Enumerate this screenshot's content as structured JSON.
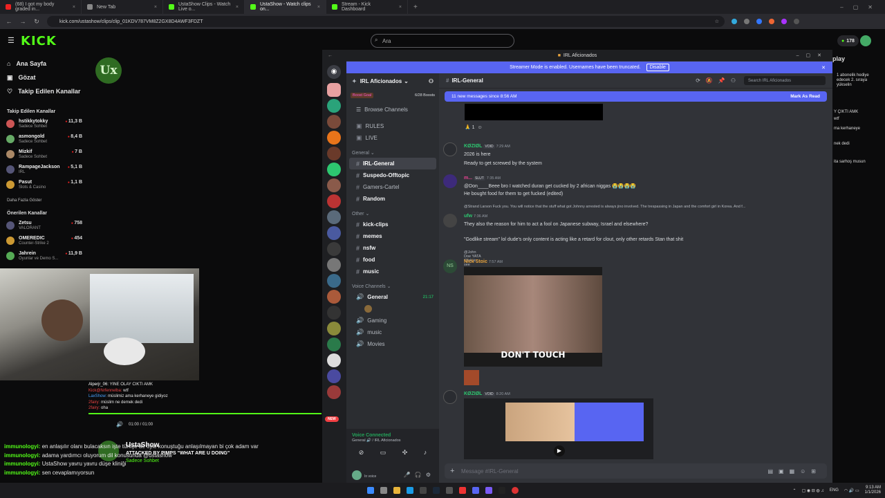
{
  "browser": {
    "tabs": [
      {
        "label": "(68) I got my body graded in..."
      },
      {
        "label": "New Tab"
      },
      {
        "label": "UstaShow Clips - Watch Live o..."
      },
      {
        "label": "UstaShow - Watch clips on..."
      },
      {
        "label": "Stream - Kick Dashboard"
      }
    ],
    "url": "kick.com/ustashow/clips/clip_01KDV787VM8Z2GX8D4AWF3FDZT"
  },
  "kick": {
    "logo": "KICK",
    "search_placeholder": "Ara",
    "credits": "178",
    "nav": [
      {
        "label": "Ana Sayfa"
      },
      {
        "label": "Gözat"
      },
      {
        "label": "Takip Edilen Kanallar"
      }
    ],
    "followed_header": "Takip Edilen Kanallar",
    "followed": [
      {
        "name": "hstikkytokky",
        "sub": "Sadece Sohbet",
        "viewers": "11,3 B"
      },
      {
        "name": "asmongold",
        "sub": "Sadece Sohbet",
        "viewers": "8,4 B"
      },
      {
        "name": "Mizkif",
        "sub": "Sadece Sohbet",
        "viewers": "7 B"
      },
      {
        "name": "RampageJackson",
        "sub": "IRL",
        "viewers": "5,1 B"
      },
      {
        "name": "Pasut",
        "sub": "Slots & Casino",
        "viewers": "1,1 B"
      }
    ],
    "show_more": "Daha Fazla Göster",
    "suggested_header": "Önerilen Kanallar",
    "suggested": [
      {
        "name": "Zetsu",
        "sub": "VALORANT",
        "viewers": "758"
      },
      {
        "name": "OMEREDIC",
        "sub": "Counter-Strike 2",
        "viewers": "454"
      },
      {
        "name": "Jahrein",
        "sub": "Oyunlar ve Demo S...",
        "viewers": "11,9 B"
      }
    ],
    "stream_logo": "Ux",
    "overlay_chat": [
      {
        "user": "Alperjr_06:",
        "text": "YINE OLAY CIKTI AMK",
        "color": "#ffffff"
      },
      {
        "user": "Kick@Nrfennelba:",
        "text": "wtf",
        "color": "#e94343"
      },
      {
        "user": "LaxShow:",
        "text": "müslimiz ama kerhaneye gidiyoz",
        "color": "#4aa3ff"
      },
      {
        "user": "2fairy:",
        "text": "müslim ne demek dedi",
        "color": "#e94343"
      },
      {
        "user": "2fairy:",
        "text": "oha",
        "color": "#e94343"
      }
    ],
    "video_time": "01:00 / 01:00",
    "streamer_name": "UstaShow",
    "streamer_sub": "Sadece Sohbet",
    "alert": "ATTACKED BY PIMPS \"WHAT ARE U DOING\"",
    "chat": [
      {
        "user": "immunologyi:",
        "text": "en anlaşılır olanı bulacaksın işte türkçe de öyle konuştuğu anlaşılmayan bi çok adam var"
      },
      {
        "user": "immunologyi:",
        "text": "adama yardımcı oluyorum dil konusunda @ustashow"
      },
      {
        "user": "immunologyi:",
        "text": "UstaShow yavru yavru düşe kliniği"
      },
      {
        "user": "immunologyi:",
        "text": "sen cevaplamıyorsun"
      }
    ],
    "right_panel": {
      "title": "play",
      "lines": [
        "1 abonelik hediye edecek 2. sıraya yükselin",
        "Y ÇIKTI AMK",
        "wtf",
        "ma kerhaneye",
        "nek dedi",
        "ita sarhoş musun"
      ]
    }
  },
  "discord": {
    "window_title": "IRL Aficionados",
    "banner": "Streamer Mode is enabled. Usernames have been truncated.",
    "banner_button": "Disable",
    "server_name": "IRL Aficionados",
    "boost_goal": "Boost Goal",
    "boosts": "6/28 Boosts",
    "browse": "Browse Channels",
    "channels_top": [
      {
        "name": "RULES"
      },
      {
        "name": "LIVE"
      }
    ],
    "cat_general": "General",
    "channels_general": [
      {
        "name": "IRL-General"
      },
      {
        "name": "Suspedo-Offtopic"
      },
      {
        "name": "Gamers-Cartel"
      },
      {
        "name": "Random"
      }
    ],
    "cat_other": "Other",
    "channels_other": [
      {
        "name": "kick-clips"
      },
      {
        "name": "memes"
      },
      {
        "name": "nsfw"
      },
      {
        "name": "food"
      },
      {
        "name": "music"
      }
    ],
    "cat_voice": "Voice Channels",
    "voice": [
      {
        "name": "General"
      },
      {
        "name": "Gaming"
      },
      {
        "name": "music"
      },
      {
        "name": "Movies"
      }
    ],
    "voice_time": "21:17",
    "voice_connected": "Voice Connected",
    "voice_sub": "General 🔊 / IRL Aficionados",
    "user_status": "In voice",
    "new_badge": "NEW",
    "chat_title": "IRL-General",
    "search_placeholder": "Search IRL Aficionados",
    "new_messages": "11 new messages since 8:56 AM",
    "mark_read": "Mark As Read",
    "reaction_count": "1",
    "messages": [
      {
        "user": "KØZIØL",
        "tag": "VOID",
        "time": "7:29 AM",
        "lines": [
          "2026 is here",
          "Ready to get screwed by the system"
        ]
      },
      {
        "user": "m...",
        "tag": "SLUT",
        "time": "7:35 AM",
        "lines": [
          "@Don____Beee bro I watched duran get cucked by 2 african niggas 😭😭😭😭",
          "He bought  food for them to get fucked (edited)"
        ]
      },
      {
        "user": "ufw",
        "reply": "@Strand Larson  Fuck you. You will notice that the stuff what got Johnny arrested is always jino involved. The trespassing in Japan and the comfort girl in Korea. And f...",
        "time": "7:36 AM",
        "lines": [
          "They also the reason for him to act a fool on Japanese subway, Israel and elsewhere?",
          "\"Godlike stream\" lol dude's only content is acting like a retard for clout, only other retards Stan that shit"
        ]
      },
      {
        "user": "Nick Stoic",
        "reply": "@John Doe  YATA  Click to see attachment",
        "time": "7:57 AM",
        "image_caption": "DON'T TOUCH"
      },
      {
        "user": "KØZIØL",
        "tag": "VOID",
        "time": "8:20 AM"
      }
    ],
    "composer_placeholder": "Message #IRL-General"
  },
  "taskbar": {
    "lang": "ENG",
    "time": "9:13 AM",
    "date": "1/1/2026"
  },
  "colors": {
    "kick_green": "#53fc18",
    "discord_blurple": "#5865f2"
  }
}
